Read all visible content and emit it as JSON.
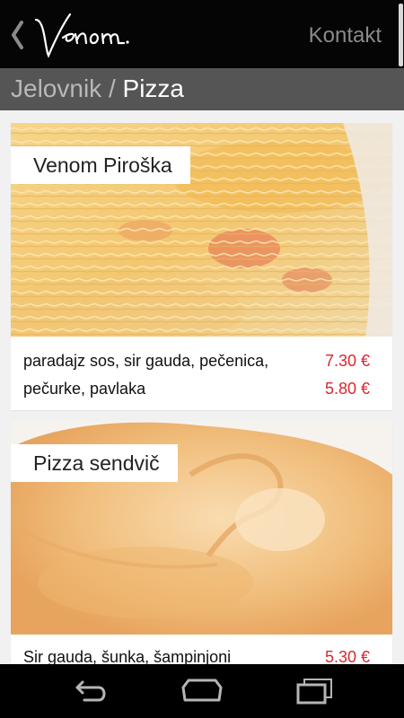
{
  "header": {
    "back_icon": "chevron-left-icon",
    "logo_text": "venom.",
    "contact_label": "Kontakt"
  },
  "breadcrumb": {
    "parent": "Jelovnik",
    "separator": " / ",
    "current": "Pizza"
  },
  "menu_items": [
    {
      "title": "Venom Piroška",
      "ingredients": [
        "paradajz sos, sir gauda, pečenica,",
        "pečurke, pavlaka"
      ],
      "prices": [
        "7.30 €",
        "5.80 €"
      ],
      "image": "spaghetti-cheese-photo"
    },
    {
      "title": "Pizza sendvič",
      "ingredients": [
        "Sir gauda, šunka, šampinjoni"
      ],
      "prices": [
        "5.30 €"
      ],
      "image": "calzone-photo"
    }
  ],
  "nav_bar": {
    "back_icon": "nav-back-icon",
    "home_icon": "nav-home-icon",
    "recent_icon": "nav-recent-apps-icon"
  },
  "colors": {
    "action_bar": "#050505",
    "breadcrumb_bar": "#555555",
    "price": "#d9272e",
    "background": "#f1f1f1"
  }
}
